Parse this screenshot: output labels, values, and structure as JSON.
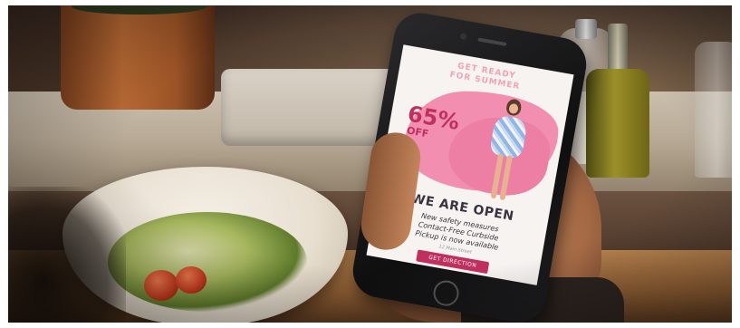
{
  "ad": {
    "headline_line1": "GET READY",
    "headline_line2": "FOR SUMMER",
    "discount": "65%",
    "discount_suffix": "OFF",
    "title": "WE ARE OPEN",
    "info_line1": "New safety measures",
    "info_line2": "Contact-Free Curbside",
    "info_line3": "Pickup is now available",
    "small_print": "12 Main Street",
    "button_label": "GET DIRECTION"
  },
  "colors": {
    "accent_pink": "#f28fb0",
    "accent_magenta": "#c0305f"
  }
}
